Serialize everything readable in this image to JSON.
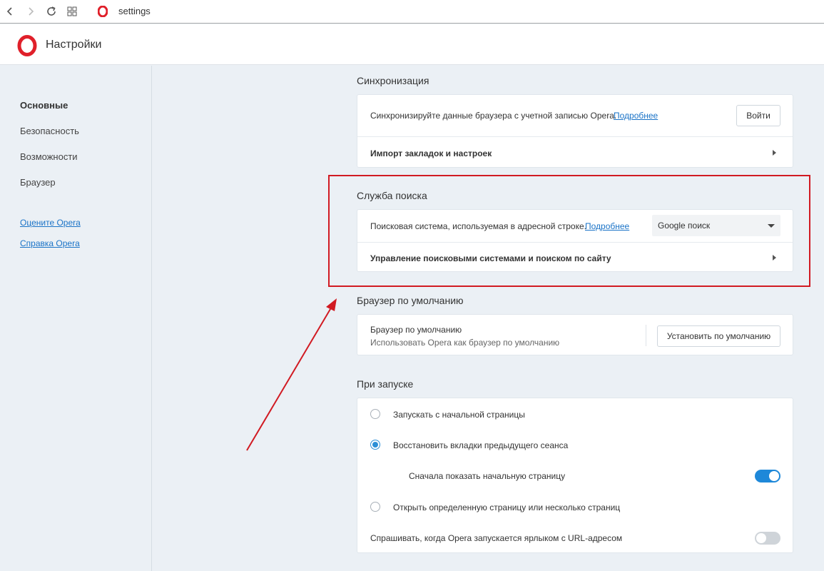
{
  "browser": {
    "url": "settings"
  },
  "header": {
    "title": "Настройки"
  },
  "sidebar": {
    "items": [
      {
        "label": "Основные"
      },
      {
        "label": "Безопасность"
      },
      {
        "label": "Возможности"
      },
      {
        "label": "Браузер"
      }
    ],
    "links": [
      {
        "label": "Оцените Opera"
      },
      {
        "label": "Справка Opera"
      }
    ]
  },
  "sync": {
    "title": "Синхронизация",
    "description": "Синхронизируйте данные браузера с учетной записью Opera.",
    "more_link": "Подробнее",
    "login_button": "Войти",
    "import_label": "Импорт закладок и настроек"
  },
  "search": {
    "title": "Служба поиска",
    "engine_label": "Поисковая система, используемая в адресной строке.",
    "more_link": "Подробнее",
    "engine_value": "Google поиск",
    "manage_label": "Управление поисковыми системами и поиском по сайту"
  },
  "default_browser": {
    "title": "Браузер по умолчанию",
    "label": "Браузер по умолчанию",
    "sublabel": "Использовать Opera как браузер по умолчанию",
    "set_button": "Установить по умолчанию"
  },
  "startup": {
    "title": "При запуске",
    "options": [
      {
        "label": "Запускать с начальной страницы",
        "selected": false
      },
      {
        "label": "Восстановить вкладки предыдущего сеанса",
        "selected": true
      },
      {
        "label": "Открыть определенную страницу или несколько страниц",
        "selected": false
      }
    ],
    "show_start_page_label": "Сначала показать начальную страницу",
    "show_start_page_on": true,
    "ask_url_label": "Спрашивать, когда Opera запускается ярлыком с URL-адресом",
    "ask_url_on": false
  },
  "colors": {
    "accent": "#1e88d9",
    "annotation": "#d11a22",
    "opera_red": "#e0202a"
  }
}
